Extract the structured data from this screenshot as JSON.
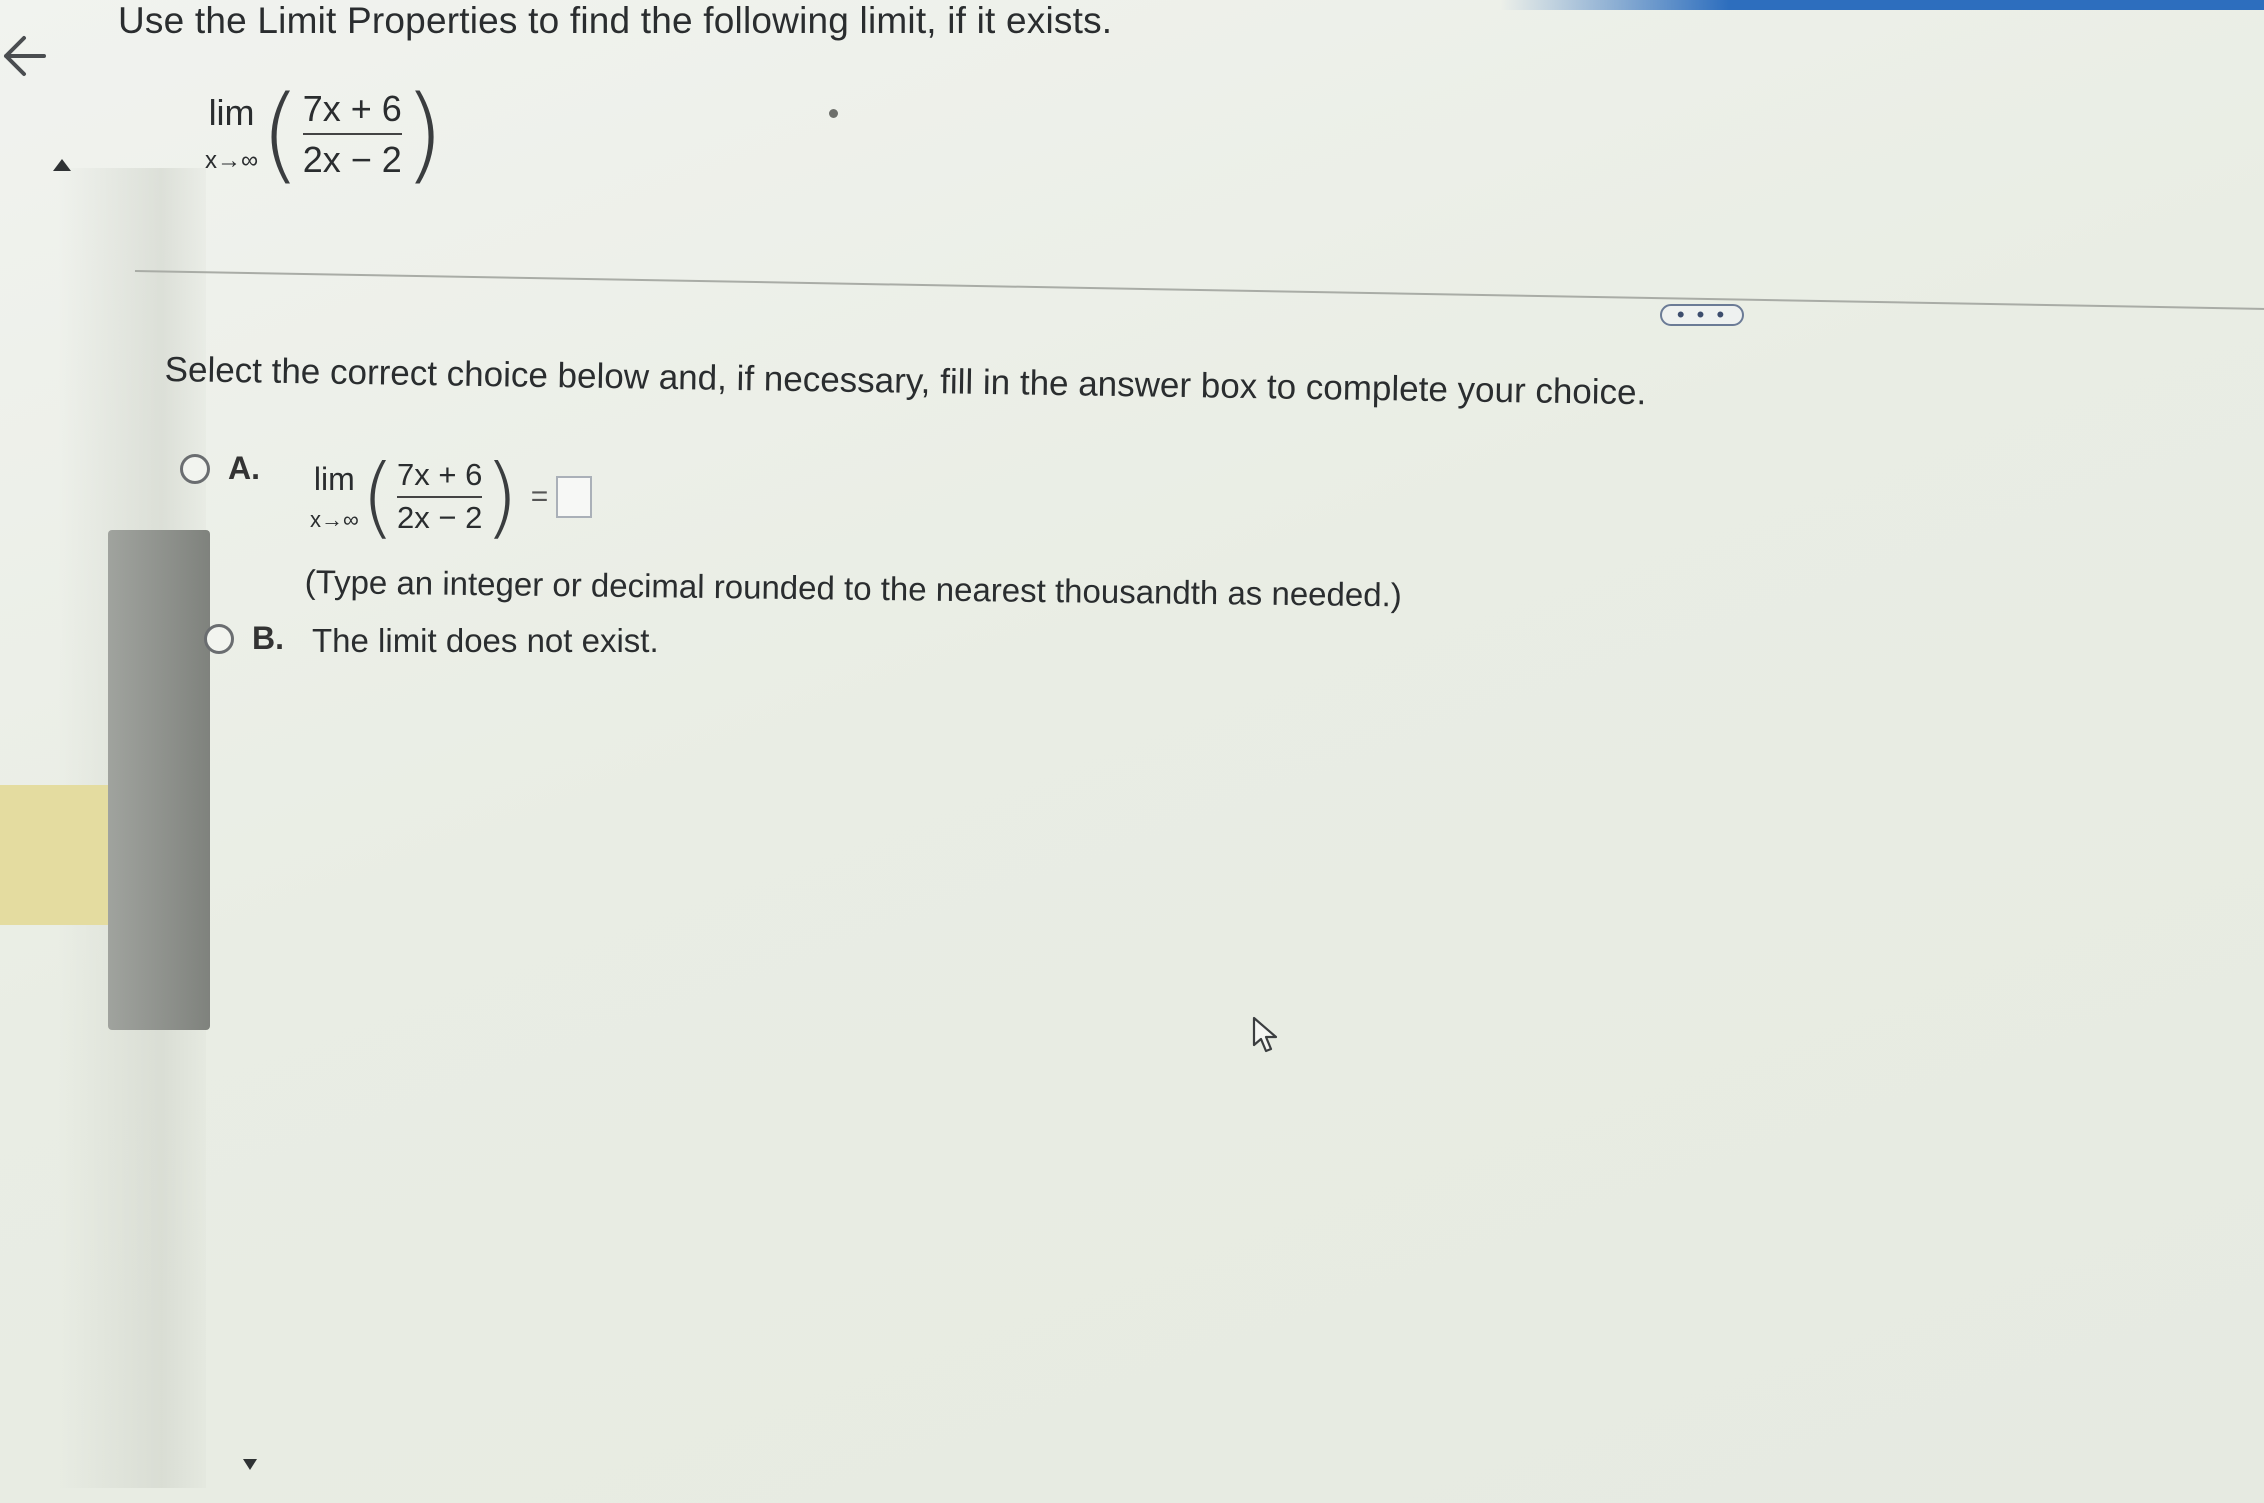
{
  "question": {
    "text": "Use the Limit Properties to find the following limit, if it exists.",
    "limit": {
      "lim": "lim",
      "sub": "x→∞",
      "numerator": "7x + 6",
      "denominator": "2x − 2"
    }
  },
  "instruction": "Select the correct choice below and, if necessary, fill in the answer box to complete your choice.",
  "choices": {
    "a": {
      "letter": "A.",
      "limit": {
        "lim": "lim",
        "sub": "x→∞",
        "numerator": "7x + 6",
        "denominator": "2x − 2"
      },
      "equals": "=",
      "answer_value": "",
      "hint": "(Type an integer or decimal rounded to the nearest thousandth as needed.)"
    },
    "b": {
      "letter": "B.",
      "text": "The limit does not exist."
    }
  },
  "more_button": "• • •",
  "icons": {
    "back": "back-arrow-icon",
    "cursor": "mouse-pointer-icon"
  },
  "colors": {
    "accent": "#2d6ebe",
    "highlight": "#e4dca0"
  }
}
